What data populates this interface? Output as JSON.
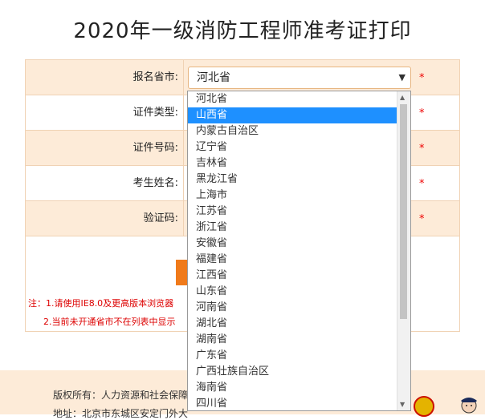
{
  "page": {
    "title": "2020年一级消防工程师准考证打印"
  },
  "form": {
    "fields": [
      {
        "label": "报名省市:",
        "required": "*"
      },
      {
        "label": "证件类型:",
        "required": "*"
      },
      {
        "label": "证件号码:",
        "required": "*"
      },
      {
        "label": "考生姓名:",
        "required": "*"
      },
      {
        "label": "验证码:",
        "required": "*"
      }
    ],
    "province_select": {
      "value": "河北省",
      "arrow": "▼"
    }
  },
  "dropdown": {
    "selected_index": 1,
    "options": [
      "河北省",
      "山西省",
      "内蒙古自治区",
      "辽宁省",
      "吉林省",
      "黑龙江省",
      "上海市",
      "江苏省",
      "浙江省",
      "安徽省",
      "福建省",
      "江西省",
      "山东省",
      "河南省",
      "湖北省",
      "湖南省",
      "广东省",
      "广西壮族自治区",
      "海南省",
      "四川省"
    ]
  },
  "notes": {
    "line1": "注：1.请使用IE8.0及更高版本浏览器",
    "line2": "2.当前未开通省市不在列表中显示"
  },
  "footer": {
    "copyright": "版权所有：人力资源和社会保障",
    "address": "地址：北京市东城区安定门外大"
  }
}
